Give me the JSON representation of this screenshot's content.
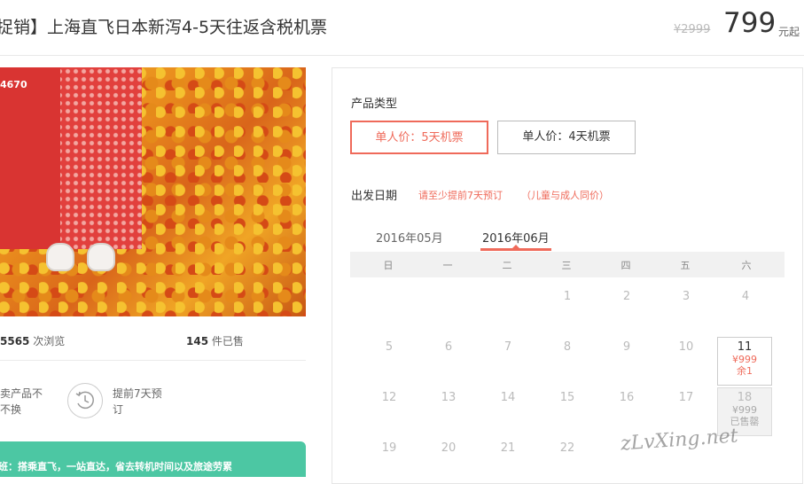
{
  "header": {
    "title": "捉销】上海直飞日本新泻4-5天往返含税机票",
    "original_price": "¥2999",
    "price": "799",
    "price_suffix": "元起"
  },
  "left": {
    "photo_id": "4670",
    "views_count": "5565",
    "views_label": "次浏览",
    "sold_count": "145",
    "sold_label": "件已售",
    "guarantee1_line1": "卖产品不",
    "guarantee1_line2": "不换",
    "guarantee2_line1": "提前7天预",
    "guarantee2_line2": "订",
    "green_text": "班：搭乘直飞，一站直达，省去转机时间以及旅途劳累"
  },
  "booking": {
    "product_type_label": "产品类型",
    "options": [
      "单人价：5天机票",
      "单人价：4天机票"
    ],
    "departure_label": "出发日期",
    "note1": "请至少提前7天预订",
    "note2": "（儿童与成人同价）",
    "months": [
      "2016年05月",
      "2016年06月"
    ],
    "weekdays": [
      "日",
      "一",
      "二",
      "三",
      "四",
      "五",
      "六"
    ],
    "row1": [
      "1",
      "2",
      "3",
      "4"
    ],
    "row2": [
      "5",
      "6",
      "7",
      "8",
      "9",
      "10"
    ],
    "row3": [
      "12",
      "13",
      "14",
      "15",
      "16",
      "17"
    ],
    "row4": [
      "19",
      "20",
      "21",
      "22"
    ],
    "available_day": {
      "day": "11",
      "price": "¥999",
      "remain": "余1"
    },
    "soldout_day": {
      "day": "18",
      "price": "¥999",
      "status": "已售罄"
    }
  },
  "watermark": "zLvXing.net",
  "colors": {
    "accent": "#ef6a5a",
    "green": "#4cc7a3"
  }
}
